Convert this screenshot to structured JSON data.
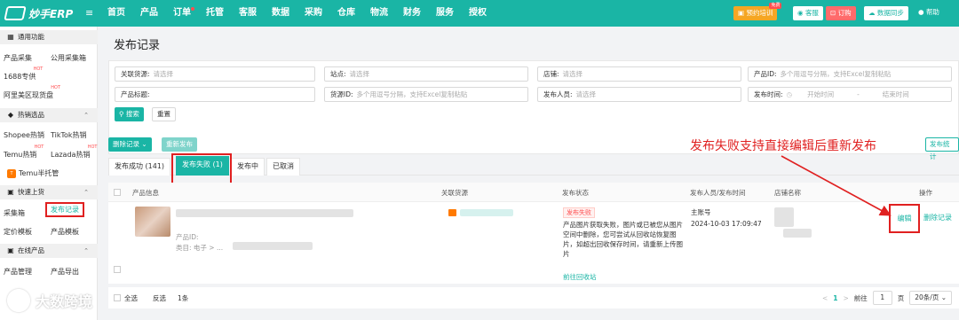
{
  "brand": {
    "name": "妙手ERP"
  },
  "nav": [
    "首页",
    "产品",
    "订单",
    "托管",
    "客服",
    "数据",
    "采购",
    "仓库",
    "物流",
    "财务",
    "服务",
    "授权"
  ],
  "topbar": {
    "train": "预约培训",
    "train_badge": "免费",
    "service": "客服",
    "order": "订购",
    "sync": "数据同步",
    "help": "帮助"
  },
  "sidebar": {
    "common": "通用功能",
    "product_collect": "产品采集",
    "public_collect": "公用采集箱",
    "source_1688": "1688专供",
    "alibaba_goods": "阿里美区现货盘",
    "hot_section": "热销选品",
    "shopee_hot": "Shopee热销",
    "tiktok_hot": "TikTok热销",
    "temu_hot": "Temu热销",
    "lazada_hot": "Lazada热销",
    "temu_hosted": "Temu半托管",
    "quick_listing": "快速上货",
    "collect_box": "采集箱",
    "publish_records": "发布记录",
    "pricing_template": "定价模板",
    "product_template": "产品模板",
    "online_products": "在线产品",
    "product_manage": "产品管理",
    "product_export": "产品导出",
    "hot_tag": "HOT"
  },
  "page": {
    "title": "发布记录"
  },
  "filters": {
    "related_source": {
      "label": "关联货源:",
      "placeholder": "请选择"
    },
    "site": {
      "label": "站点:",
      "placeholder": "请选择"
    },
    "shop": {
      "label": "店铺:",
      "placeholder": "请选择"
    },
    "product_id": {
      "label": "产品ID:",
      "placeholder": "多个用逗号分隔，支持Excel复制粘贴"
    },
    "product_title": {
      "label": "产品标题:",
      "placeholder": ""
    },
    "source_id": {
      "label": "货源ID:",
      "placeholder": "多个用逗号分隔，支持Excel复制粘贴"
    },
    "publisher": {
      "label": "发布人员:",
      "placeholder": "请选择"
    },
    "publish_time": {
      "label": "发布时间:",
      "start": "开始时间",
      "sep": "-",
      "end": "结束时间"
    },
    "search": "搜索",
    "reset": "重置"
  },
  "toolbar": {
    "delete_records": "删除记录",
    "republish": "重新发布",
    "publish_stats": "发布统计"
  },
  "annotation": "发布失败支持直接编辑后重新发布",
  "tabs": [
    "发布成功 (141)",
    "发布失败 (1)",
    "发布中",
    "已取消"
  ],
  "table": {
    "headers": [
      "产品信息",
      "关联货源",
      "发布状态",
      "发布人员/发布时间",
      "店铺名称",
      "操作"
    ],
    "row": {
      "id_label": "产品ID:",
      "category_label": "类目: 电子 > ...",
      "status_tag": "发布失败",
      "status_msg": "产品图片获取失败，图片或已被您从图片空间中删除，您可尝试从回收站恢复图片，如超出回收保存时间，请重新上传图片",
      "recycle_link": "前往回收站",
      "publisher": "主账号",
      "time": "2024-10-03 17:09:47",
      "edit": "编辑",
      "delete": "删除记录"
    }
  },
  "footer": {
    "select_all": "全选",
    "invert": "反选",
    "count": "1条",
    "prev": "<",
    "page": "1",
    "next": ">",
    "goto": "前往",
    "page_input": "1",
    "page_unit": "页",
    "page_size": "20条/页"
  },
  "watermark": "大数跨境",
  "colors": {
    "accent": "#1ab5a5",
    "annotation": "#e02020",
    "error": "#ff4d4f"
  }
}
